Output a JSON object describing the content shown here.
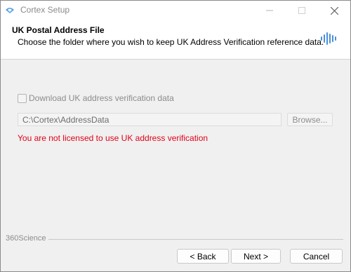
{
  "window": {
    "title": "Cortex Setup"
  },
  "header": {
    "title": "UK Postal Address File",
    "subtitle": "Choose the folder where you wish to keep UK Address Verification reference data."
  },
  "content": {
    "checkbox_label": "Download UK address verification data",
    "checkbox_checked": false,
    "path_value": "C:\\Cortex\\AddressData",
    "browse_label": "Browse...",
    "error_text": "You are not licensed to use UK address verification",
    "error_color": "#e0001a"
  },
  "footer": {
    "brand": "360Science",
    "back_label": "< Back",
    "next_label": "Next >",
    "cancel_label": "Cancel"
  }
}
